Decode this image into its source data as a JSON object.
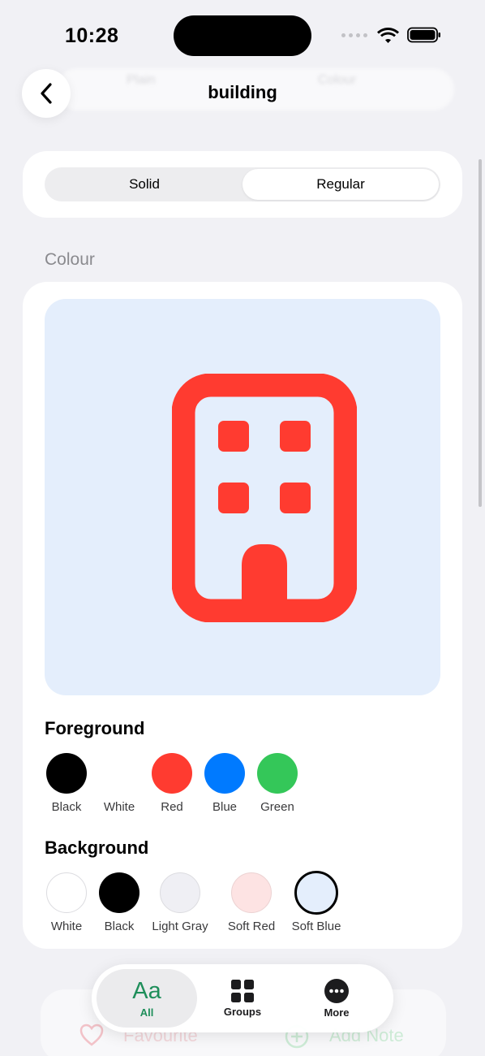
{
  "status_bar": {
    "time": "10:28"
  },
  "nav": {
    "title": "building",
    "ghost_left": "Plain",
    "ghost_right": "Colour"
  },
  "weight_segment": {
    "options": [
      "Solid",
      "Regular"
    ],
    "selected": "Regular"
  },
  "section": {
    "label": "Colour"
  },
  "preview": {
    "icon": "building-icon",
    "foreground_color": "#FF3B30",
    "background_color": "#E4EEFC"
  },
  "foreground": {
    "title": "Foreground",
    "options": [
      {
        "label": "Black",
        "color": "#000000"
      },
      {
        "label": "White",
        "color": "#FFFFFF"
      },
      {
        "label": "Red",
        "color": "#FF3B30"
      },
      {
        "label": "Blue",
        "color": "#007AFF"
      },
      {
        "label": "Green",
        "color": "#34C759"
      }
    ],
    "selected": "Red"
  },
  "background": {
    "title": "Background",
    "options": [
      {
        "label": "White",
        "color": "#FFFFFF"
      },
      {
        "label": "Black",
        "color": "#000000"
      },
      {
        "label": "Light Gray",
        "color": "#EFEFF4"
      },
      {
        "label": "Soft Red",
        "color": "#FDE3E3"
      },
      {
        "label": "Soft Blue",
        "color": "#E4EEFC"
      }
    ],
    "selected": "Soft Blue"
  },
  "bottom_actions": {
    "favourite": "Favourite",
    "add_note": "Add Note"
  },
  "tab_bar": {
    "tabs": [
      {
        "label": "All",
        "glyph": "Aa",
        "icon": "text-aa-icon"
      },
      {
        "label": "Groups",
        "icon": "grid-icon"
      },
      {
        "label": "More",
        "icon": "ellipsis-circle-icon"
      }
    ],
    "selected": "All"
  }
}
